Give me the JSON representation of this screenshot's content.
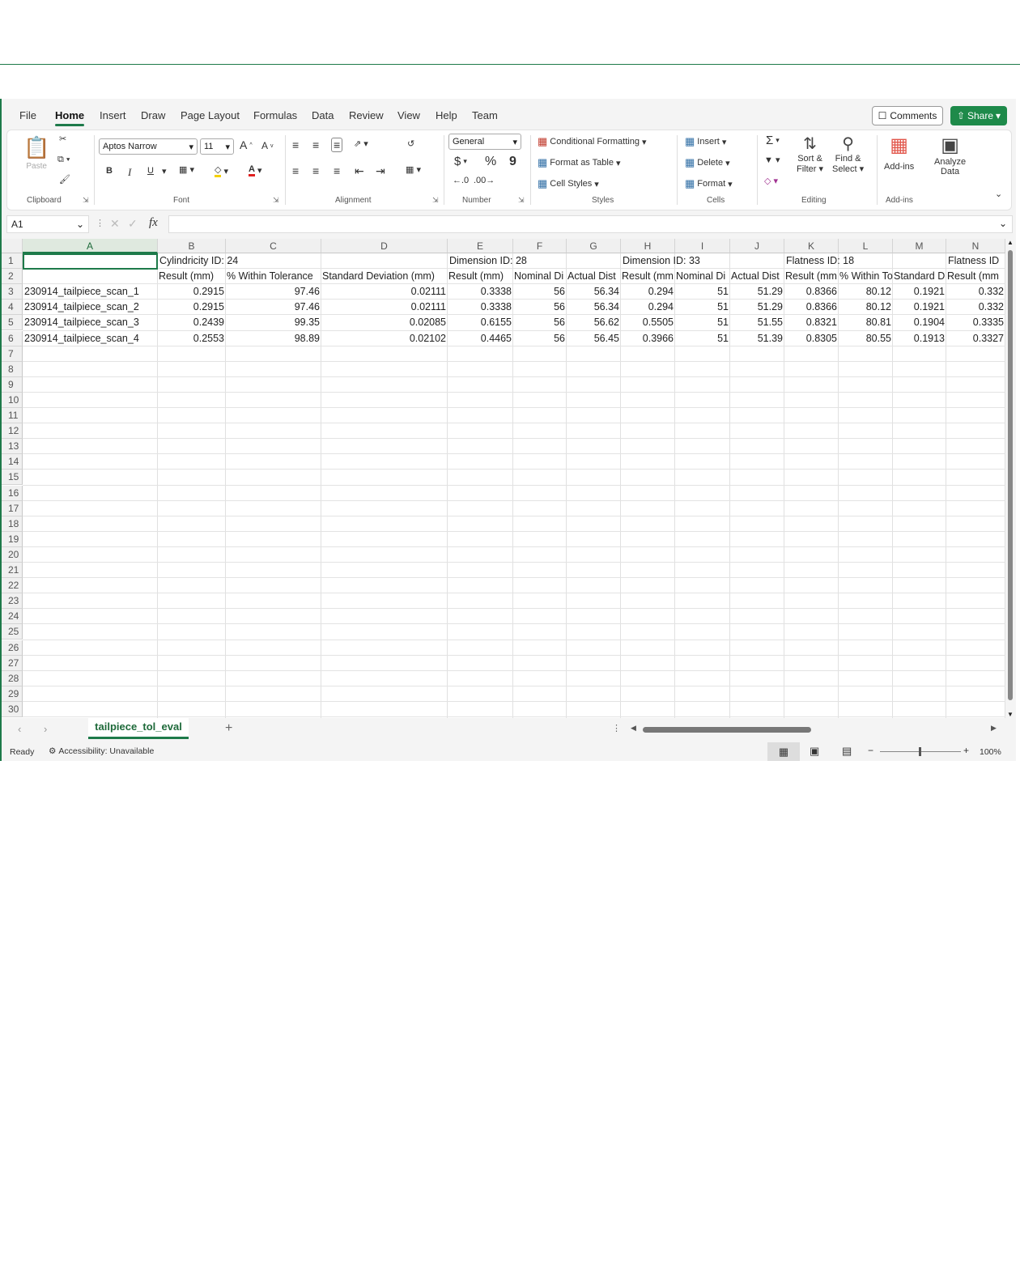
{
  "menu": {
    "items": [
      "File",
      "Home",
      "Insert",
      "Draw",
      "Page Layout",
      "Formulas",
      "Data",
      "Review",
      "View",
      "Help",
      "Team"
    ],
    "active": "Home",
    "comments_label": "Comments",
    "share_label": "Share"
  },
  "ribbon": {
    "clipboard": {
      "paste_label": "Paste",
      "group_label": "Clipboard"
    },
    "font": {
      "font_name": "Aptos Narrow",
      "font_size": "11",
      "bold": "B",
      "italic": "I",
      "underline": "U",
      "grow": "A",
      "shrink": "A",
      "group_label": "Font"
    },
    "alignment": {
      "group_label": "Alignment"
    },
    "number": {
      "format": "General",
      "currency": "$",
      "percent": "%",
      "comma": "9",
      "group_label": "Number"
    },
    "styles": {
      "conditional_formatting": "Conditional Formatting",
      "format_as_table": "Format as Table",
      "cell_styles": "Cell Styles",
      "group_label": "Styles"
    },
    "cells": {
      "insert": "Insert",
      "delete": "Delete",
      "format": "Format",
      "group_label": "Cells"
    },
    "editing": {
      "autosum": "Σ",
      "sort_filter_1": "Sort &",
      "sort_filter_2": "Filter",
      "find_select_1": "Find &",
      "find_select_2": "Select",
      "group_label": "Editing"
    },
    "addins": {
      "addins_label": "Add-ins",
      "analyze_1": "Analyze",
      "analyze_2": "Data",
      "group_label": "Add-ins"
    }
  },
  "formula_bar": {
    "name_box": "A1",
    "fx": "fx",
    "formula": ""
  },
  "sheet": {
    "columns": [
      "A",
      "B",
      "C",
      "D",
      "E",
      "F",
      "G",
      "H",
      "I",
      "J",
      "K",
      "L",
      "M",
      "N"
    ],
    "selected_column": "A",
    "row_count": 30,
    "row1": {
      "B": "Cylindricity ID: 24",
      "E": "Dimension ID: 28",
      "H": "Dimension ID: 33",
      "K": "Flatness ID: 18",
      "N": "Flatness ID"
    },
    "row2": [
      "Result (mm)",
      "% Within Tolerance",
      "Standard Deviation (mm)",
      "Result (mm)",
      "Nominal Di",
      "Actual Dist",
      "Result (mm",
      "Nominal Di",
      "Actual Dist",
      "Result (mm",
      "% Within To",
      "Standard D",
      "Result (mm"
    ],
    "rows": [
      {
        "name": "230914_tailpiece_scan_1",
        "values": [
          "0.2915",
          "97.46",
          "0.02111",
          "0.3338",
          "56",
          "56.34",
          "0.294",
          "51",
          "51.29",
          "0.8366",
          "80.12",
          "0.1921",
          "0.332"
        ]
      },
      {
        "name": "230914_tailpiece_scan_2",
        "values": [
          "0.2915",
          "97.46",
          "0.02111",
          "0.3338",
          "56",
          "56.34",
          "0.294",
          "51",
          "51.29",
          "0.8366",
          "80.12",
          "0.1921",
          "0.332"
        ]
      },
      {
        "name": "230914_tailpiece_scan_3",
        "values": [
          "0.2439",
          "99.35",
          "0.02085",
          "0.6155",
          "56",
          "56.62",
          "0.5505",
          "51",
          "51.55",
          "0.8321",
          "80.81",
          "0.1904",
          "0.3335"
        ]
      },
      {
        "name": "230914_tailpiece_scan_4",
        "values": [
          "0.2553",
          "98.89",
          "0.02102",
          "0.4465",
          "56",
          "56.45",
          "0.3966",
          "51",
          "51.39",
          "0.8305",
          "80.55",
          "0.1913",
          "0.3327"
        ]
      }
    ]
  },
  "tabs": {
    "sheet_name": "tailpiece_tol_eval",
    "add": "+"
  },
  "status": {
    "ready": "Ready",
    "accessibility": "Accessibility: Unavailable",
    "zoom": "100%"
  }
}
